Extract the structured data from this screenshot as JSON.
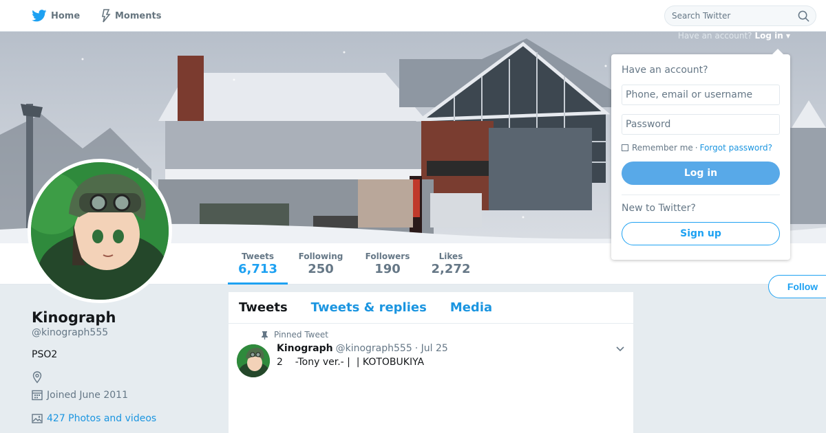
{
  "nav": {
    "home_label": "Home",
    "home_icon": "twitter-bird-icon",
    "moments_label": "Moments",
    "moments_icon": "lightning-icon",
    "search_placeholder": "Search Twitter",
    "search_icon": "search-icon"
  },
  "account_prompt": {
    "text": "Have an account?",
    "login_label": "Log in"
  },
  "login_dropdown": {
    "title": "Have an account?",
    "username_placeholder": "Phone, email or username",
    "password_placeholder": "Password",
    "remember_label": "Remember me",
    "separator": "·",
    "forgot_label": "Forgot password?",
    "login_button": "Log in",
    "new_title": "New to Twitter?",
    "signup_button": "Sign up"
  },
  "stats": [
    {
      "label": "Tweets",
      "value": "6,713",
      "active": true
    },
    {
      "label": "Following",
      "value": "250"
    },
    {
      "label": "Followers",
      "value": "190"
    },
    {
      "label": "Likes",
      "value": "2,272"
    }
  ],
  "follow_button": "Follow",
  "profile": {
    "name": "Kinograph",
    "handle": "@kinograph555",
    "bio": "PSO2",
    "joined": "Joined June 2011",
    "media": "427 Photos and videos"
  },
  "timeline": {
    "tabs": [
      "Tweets",
      "Tweets & replies",
      "Media"
    ],
    "pinned_label": "Pinned Tweet",
    "tweet": {
      "name": "Kinograph",
      "handle": "@kinograph555",
      "date": "· Jul 25",
      "text": "2    -Tony ver.- |  | KOTOBUKIYA"
    }
  },
  "colors": {
    "accent": "#1da1f2",
    "link": "#1b95e0",
    "muted": "#657786",
    "background": "#e6ecf0"
  }
}
